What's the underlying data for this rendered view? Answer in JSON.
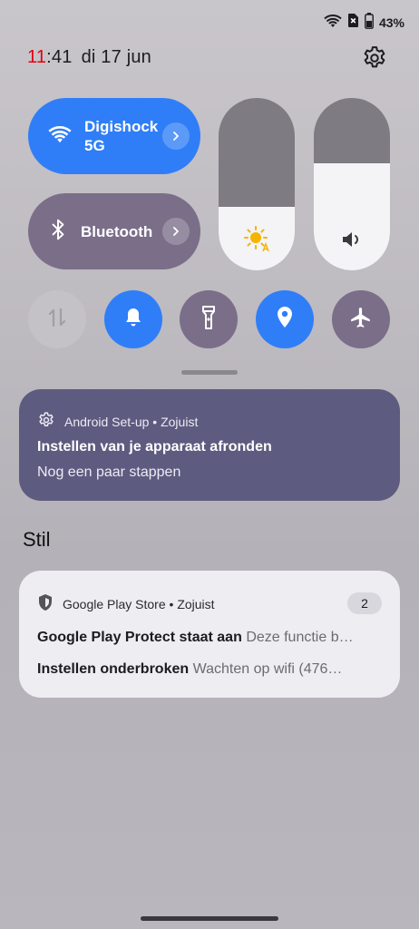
{
  "status_bar": {
    "battery_percent": "43%"
  },
  "header": {
    "clock_hour": "11",
    "clock_minute": ":41",
    "date": "di 17 jun"
  },
  "tiles": {
    "wifi": {
      "label_line1": "Digishock",
      "label_line2": "5G",
      "active": true
    },
    "bluetooth": {
      "label": "Bluetooth",
      "active": false
    }
  },
  "sliders": {
    "brightness_level": 0.37,
    "volume_level": 0.62
  },
  "toggles": [
    {
      "name": "mobile-data",
      "active": false
    },
    {
      "name": "do-not-disturb",
      "active": true
    },
    {
      "name": "flashlight",
      "active": false
    },
    {
      "name": "location",
      "active": true
    },
    {
      "name": "airplane-mode",
      "active": false
    }
  ],
  "notifications": {
    "setup": {
      "app": "Android Set-up",
      "time": "Zojuist",
      "title": "Instellen van je apparaat afronden",
      "text": "Nog een paar stappen"
    },
    "section_title": "Stil",
    "play": {
      "app": "Google Play Store",
      "time": "Zojuist",
      "count": "2",
      "rows": [
        {
          "title": "Google Play Protect staat aan",
          "text": "Deze functie b…"
        },
        {
          "title": "Instellen onderbroken",
          "text": "Wachten op wifi (476…"
        }
      ]
    }
  },
  "colors": {
    "accent_blue": "#2f7ef7",
    "inactive_purple": "#7a6e89",
    "notification_setup_bg": "#5d5b7f",
    "clock_hour_red": "#e3000f"
  }
}
